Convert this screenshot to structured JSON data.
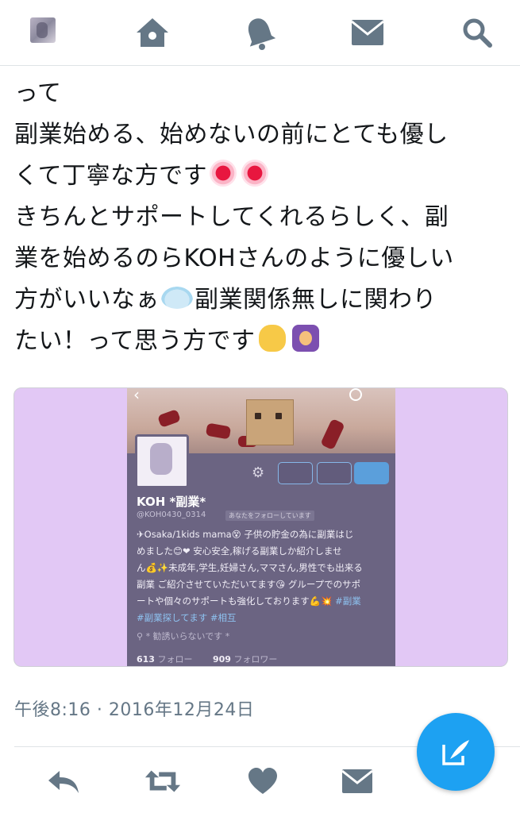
{
  "colors": {
    "accent": "#1da1f2",
    "icon": "#657786",
    "text": "#14171a",
    "media_background": "#e2c8f5"
  },
  "nav": {
    "icons": [
      "avatar",
      "home-icon",
      "bell-icon",
      "mail-icon",
      "search-icon"
    ]
  },
  "tweet": {
    "line1": "って",
    "line2": "副業始める、始めないの前にとても優し",
    "line3": "くて丁寧な方です",
    "line4": "きちんとサポートしてくれるらしく、副",
    "line5": "業を始めるのらKOHさんのように優しい",
    "line6a": "方がいいなぁ",
    "line6b": "副業関係無しに関わり",
    "line7": "たい！って思う方です",
    "timestamp": "午後8:16 · 2016年12月24日"
  },
  "embedded_profile": {
    "name": "KOH *副業*",
    "handle": "@KOH0430_0314",
    "follows_you": "あなたをフォローしています",
    "bio_line1": "✈Osaka/1kids mama😵 子供の貯金の為に副業はじ",
    "bio_line2": "めました😊❤ 安心安全,稼げる副業しか紹介しませ",
    "bio_line3": "ん💰✨未成年,学生,妊婦さん,ママさん,男性でも出来る",
    "bio_line4": "副業 ご紹介させていただいてます😘 グループでのサポ",
    "bio_line5": "ートや個々のサポートも強化しております💪💥",
    "bio_tag1": "#副業",
    "bio_tag2": "#副業探してます #相互",
    "location": "* 勧誘いらないです *",
    "following_count": "613",
    "following_label": "フォロー",
    "followers_count": "909",
    "followers_label": "フォロワー"
  },
  "actions": [
    "reply-icon",
    "retweet-icon",
    "like-icon",
    "dm-icon"
  ],
  "fab": {
    "icon": "compose-icon"
  }
}
